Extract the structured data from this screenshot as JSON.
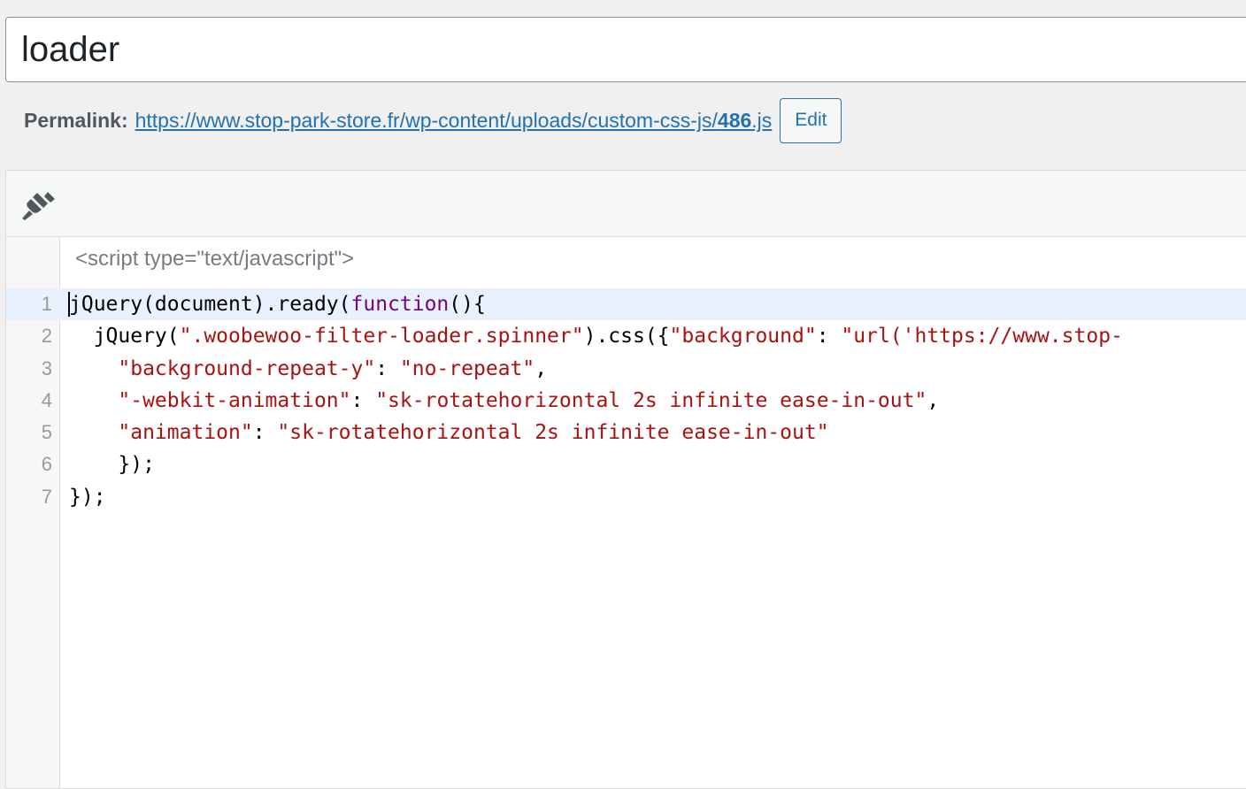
{
  "post_title": {
    "value": "loader"
  },
  "permalink": {
    "label": "Permalink:",
    "url_prefix": "https://www.stop-park-store.fr/wp-content/uploads/custom-css-js/",
    "url_slug": "486",
    "url_suffix": ".js",
    "edit_label": "Edit"
  },
  "toolbar": {
    "icon": "paintbrush-icon"
  },
  "editor": {
    "script_open_tag": "<script type=\"text/javascript\">",
    "lines": [
      {
        "number": "1",
        "tokens": [
          {
            "t": "jQuery(document).ready(",
            "c": "plain"
          },
          {
            "t": "function",
            "c": "kw"
          },
          {
            "t": "(){",
            "c": "plain"
          }
        ]
      },
      {
        "number": "2",
        "tokens": [
          {
            "t": "  jQuery(",
            "c": "plain"
          },
          {
            "t": "\".woobewoo-filter-loader.spinner\"",
            "c": "str"
          },
          {
            "t": ").css({",
            "c": "plain"
          },
          {
            "t": "\"background\"",
            "c": "str"
          },
          {
            "t": ": ",
            "c": "plain"
          },
          {
            "t": "\"url('https://www.stop-",
            "c": "str"
          }
        ]
      },
      {
        "number": "3",
        "tokens": [
          {
            "t": "    ",
            "c": "plain"
          },
          {
            "t": "\"background-repeat-y\"",
            "c": "str"
          },
          {
            "t": ": ",
            "c": "plain"
          },
          {
            "t": "\"no-repeat\"",
            "c": "str"
          },
          {
            "t": ",",
            "c": "plain"
          }
        ]
      },
      {
        "number": "4",
        "tokens": [
          {
            "t": "    ",
            "c": "plain"
          },
          {
            "t": "\"-webkit-animation\"",
            "c": "str"
          },
          {
            "t": ": ",
            "c": "plain"
          },
          {
            "t": "\"sk-rotatehorizontal 2s infinite ease-in-out\"",
            "c": "str"
          },
          {
            "t": ",",
            "c": "plain"
          }
        ]
      },
      {
        "number": "5",
        "tokens": [
          {
            "t": "    ",
            "c": "plain"
          },
          {
            "t": "\"animation\"",
            "c": "str"
          },
          {
            "t": ": ",
            "c": "plain"
          },
          {
            "t": "\"sk-rotatehorizontal 2s infinite ease-in-out\"",
            "c": "str"
          }
        ]
      },
      {
        "number": "6",
        "tokens": [
          {
            "t": "    });",
            "c": "plain"
          }
        ]
      },
      {
        "number": "7",
        "tokens": [
          {
            "t": "});",
            "c": "plain"
          }
        ]
      }
    ],
    "active_line": 1
  },
  "colors": {
    "link": "#2271b1",
    "keyword": "#770088",
    "string": "#aa1111",
    "active_line_bg": "#e8f2ff"
  }
}
